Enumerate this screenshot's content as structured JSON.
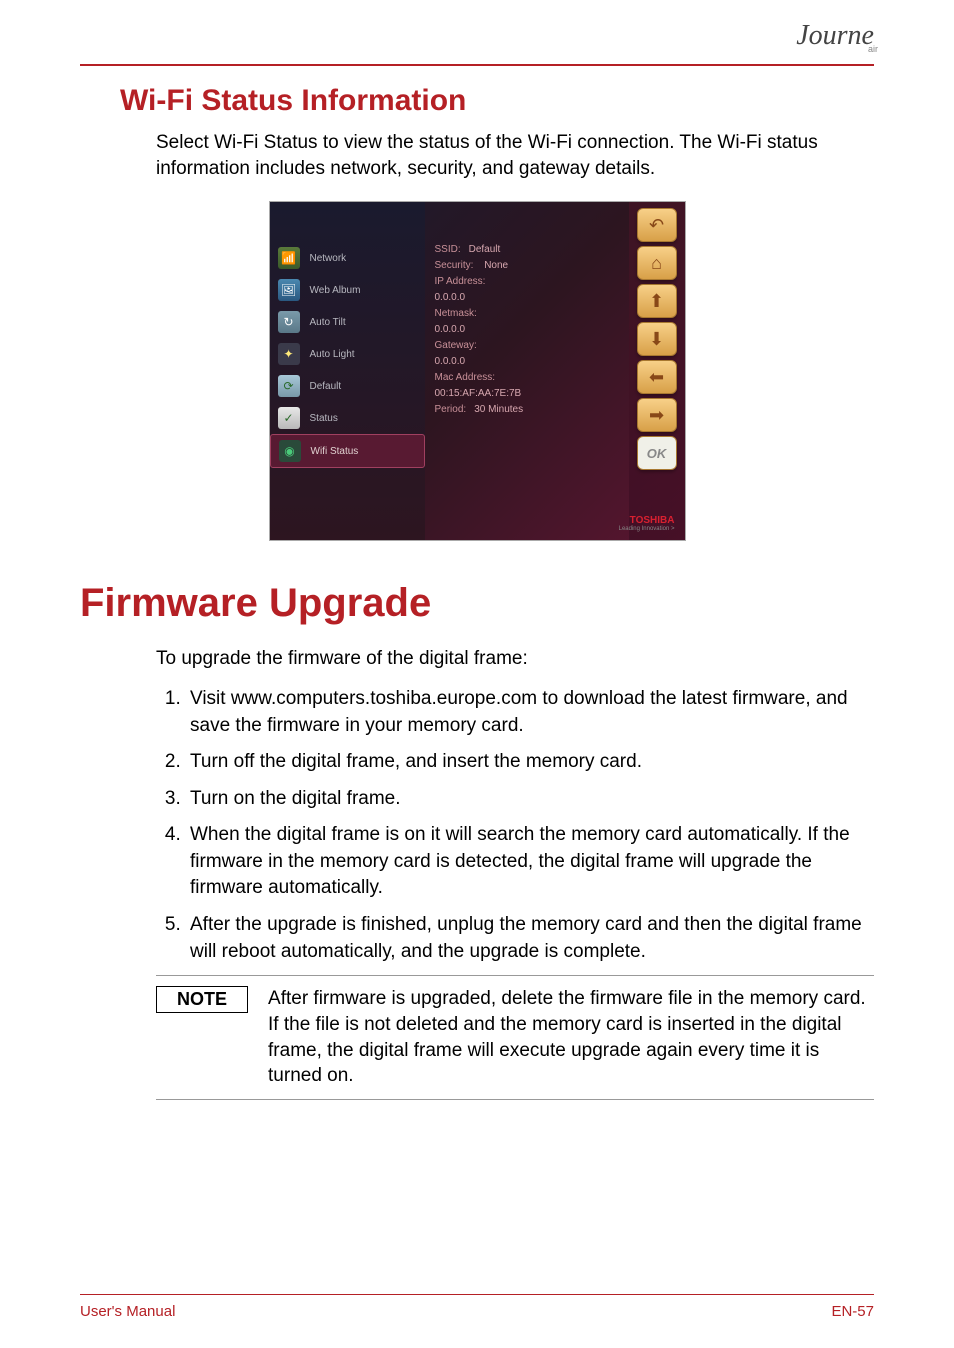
{
  "brand": {
    "logo_script": "Journe",
    "logo_sub": "air"
  },
  "section1": {
    "title": "Wi-Fi Status Information",
    "intro": "Select Wi-Fi Status to view the status of the Wi-Fi connection. The Wi-Fi status information includes network, security, and gateway details."
  },
  "screenshot": {
    "menu": [
      {
        "label": "Network",
        "icon": "wifi"
      },
      {
        "label": "Web Album",
        "icon": "album"
      },
      {
        "label": "Auto Tilt",
        "icon": "tilt"
      },
      {
        "label": "Auto Light",
        "icon": "light"
      },
      {
        "label": "Default",
        "icon": "def"
      },
      {
        "label": "Status",
        "icon": "status"
      },
      {
        "label": "Wifi Status",
        "icon": "wstat",
        "selected": true
      }
    ],
    "info": {
      "ssid_label": "SSID:",
      "ssid_value": "Default",
      "security_label": "Security:",
      "security_value": "None",
      "ip_label": "IP Address:",
      "ip_value": "0.0.0.0",
      "netmask_label": "Netmask:",
      "netmask_value": "0.0.0.0",
      "gateway_label": "Gateway:",
      "gateway_value": "0.0.0.0",
      "mac_label": "Mac Address:",
      "mac_value": "00:15:AF:AA:7E:7B",
      "period_label": "Period:",
      "period_value": "30 Minutes"
    },
    "right_buttons": {
      "back": "↶",
      "home": "⌂",
      "up": "⬆",
      "down": "⬇",
      "left": "⬅",
      "right": "➡",
      "ok": "OK"
    },
    "brand_name": "TOSHIBA",
    "brand_tag": "Leading Innovation >"
  },
  "chapter": {
    "title": "Firmware Upgrade",
    "intro": "To upgrade the firmware of the digital frame:",
    "steps": [
      "Visit www.computers.toshiba.europe.com to download the latest firmware, and save the firmware in your memory card.",
      "Turn off the digital frame, and insert the memory card.",
      "Turn on the digital frame.",
      "When the digital frame is on it will search the memory card automatically. If the firmware in the memory card is detected, the digital frame will upgrade the firmware automatically.",
      "After the upgrade is finished, unplug the memory card and then the digital frame will reboot automatically, and the upgrade is complete."
    ]
  },
  "note": {
    "label": "NOTE",
    "text": "After firmware is upgraded, delete the firmware file in the memory card. If the file is not deleted and the memory card is inserted in the digital frame, the digital frame will execute upgrade again every time it is turned on."
  },
  "footer": {
    "left": "User's Manual",
    "right": "EN-57"
  }
}
